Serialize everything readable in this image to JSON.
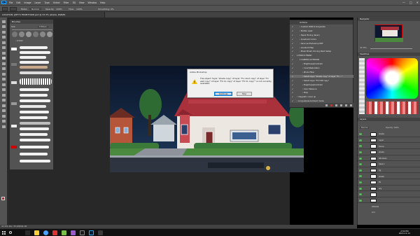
{
  "menubar": {
    "app_icon": "Ps",
    "items": [
      "File",
      "Edit",
      "Image",
      "Layer",
      "Type",
      "Select",
      "Filter",
      "3D",
      "View",
      "Window",
      "Help"
    ],
    "window_controls": [
      "—",
      "□",
      "✕"
    ]
  },
  "optbar": {
    "mode_label": "Mode:",
    "mode_value": "Normal",
    "opacity_label": "Opacity:",
    "opacity_value": "100%",
    "flow_label": "Flow:",
    "flow_value": "100%",
    "smoothing_label": "Smoothing:",
    "smoothing_value": "0%"
  },
  "document_tab": {
    "title": "LOCATION: JOEY'S FRONTYARD.psd @ 33.3% (shade, RGB/8)"
  },
  "brushes_panel": {
    "title": "Brushes",
    "size_label": "Size:",
    "size_value": "1700 px",
    "group_label": "› Artistic"
  },
  "dialog": {
    "title": "Adobe Photoshop",
    "message": "The object \"layer \"shade copy\" of layer \"Fx cloud copy\" of layer \"Fx wall copy\" of layer \"FX CL copy\" of layer \"FX CL copy\"\" is not currently available.",
    "continue_label": "Continue",
    "stop_label": "Stop"
  },
  "actions_panel": {
    "title": "Actions",
    "items": [
      {
        "check": "✓",
        "label": "› Custom RGB to Grayscale",
        "indent": 1,
        "selected": false
      },
      {
        "check": "✓",
        "label": "› Molten Lead",
        "indent": 1,
        "selected": false
      },
      {
        "check": "✓",
        "label": "› Sepia Toning (layer)",
        "indent": 1,
        "selected": false
      },
      {
        "check": "✓",
        "label": "› Quadrant Colors",
        "indent": 1,
        "selected": false
      },
      {
        "check": "✓",
        "label": "› Save as Photoshop PDF",
        "indent": 1,
        "selected": false
      },
      {
        "check": "✓",
        "label": "› Gradient Map",
        "indent": 1,
        "selected": false
      },
      {
        "check": "✓",
        "label": "› Mixer Brush Cloning Paint Setup",
        "indent": 1,
        "selected": false
      },
      {
        "check": "✓",
        "label": "▾ PHOTO FINISH",
        "indent": 0,
        "selected": false
      },
      {
        "check": "✓",
        "label": "▾ CAMERA OUTDOOR",
        "indent": 1,
        "selected": false
      },
      {
        "check": "✓",
        "label": "› Brightness/Contrast",
        "indent": 2,
        "selected": false
      },
      {
        "check": "✓",
        "label": "› Invert/Saturation",
        "indent": 2,
        "selected": false
      },
      {
        "check": "✓",
        "label": "› Photo Filter",
        "indent": 2,
        "selected": false
      },
      {
        "check": "✓",
        "label": "› Select layer \"shade copy\" of layer \"Fx ...\"",
        "indent": 2,
        "selected": true
      },
      {
        "check": "✓",
        "label": "› Select layer \"FX TOP copy\"",
        "indent": 2,
        "selected": false
      },
      {
        "check": "✓",
        "label": "› Brightness/Contrast",
        "indent": 2,
        "selected": false
      },
      {
        "check": "✓",
        "label": "› Color Balance",
        "indent": 2,
        "selected": false
      },
      {
        "check": "✓",
        "label": "› Stop",
        "indent": 2,
        "selected": false
      },
      {
        "check": "✓",
        "label": "› magnetic cover up",
        "indent": 0,
        "selected": false
      },
      {
        "check": "✓",
        "label": "› Long exposure blend mode",
        "indent": 0,
        "selected": false
      }
    ]
  },
  "navigator": {
    "title": "Navigator",
    "zoom": "33.33%"
  },
  "color_panel": {
    "title": "Swatches"
  },
  "layers_panel": {
    "title": "Layers",
    "blend_mode": "Normal",
    "opacity": "Opacity: 100%",
    "rows": [
      "shade",
      "Layer",
      "Fence",
      "shade",
      "Windows",
      "base 1",
      "bg",
      "shade",
      "fill",
      "sky",
      "",
      ""
    ],
    "groups": [
      "DESIGN",
      "Grd"
    ]
  },
  "statusbar": {
    "text": "33.33%    Doc: 35.1M/504.1M"
  },
  "taskbar": {
    "time": "2:52 PM",
    "date": "2021-11-12"
  },
  "colors": {
    "accent": "#31a8ff",
    "panel": "#535353",
    "panel_dark": "#424242",
    "canvas_bg": "#282828"
  }
}
